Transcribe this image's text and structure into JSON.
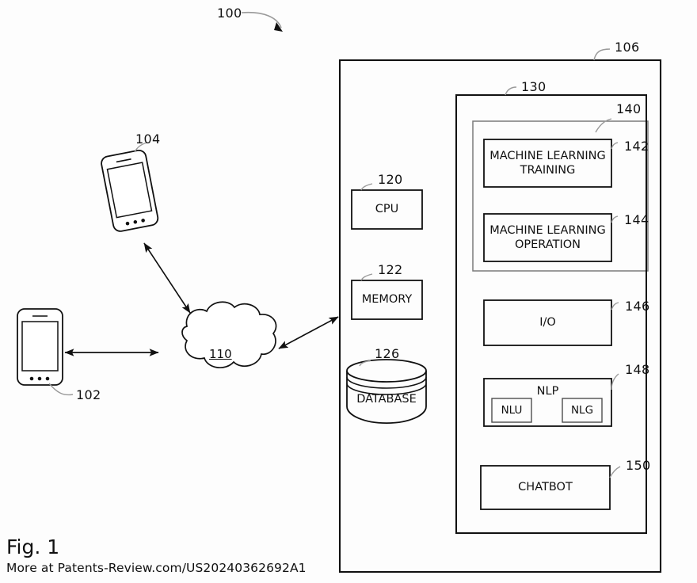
{
  "figure": {
    "caption": "Fig. 1",
    "footer": "More at Patents-Review.com/US20240362692A1",
    "top_ref": "100"
  },
  "network": {
    "cloud_label": "110",
    "devices": [
      {
        "ref": "104",
        "name": "mobile-device-upper"
      },
      {
        "ref": "102",
        "name": "mobile-device-lower"
      }
    ]
  },
  "server": {
    "ref": "106",
    "hardware": [
      {
        "ref": "120",
        "label": "CPU"
      },
      {
        "ref": "122",
        "label": "MEMORY"
      },
      {
        "ref": "126",
        "label": "DATABASE"
      }
    ],
    "modules_container_ref": "130",
    "ml_container_ref": "140",
    "modules": [
      {
        "ref": "142",
        "label": "MACHINE LEARNING\nTRAINING"
      },
      {
        "ref": "144",
        "label": "MACHINE LEARNING\nOPERATION"
      },
      {
        "ref": "146",
        "label": "I/O"
      },
      {
        "ref": "148",
        "label": "NLP"
      },
      {
        "ref": "150",
        "label": "CHATBOT"
      }
    ],
    "nlp_children": [
      {
        "label": "NLU"
      },
      {
        "label": "NLG"
      }
    ]
  }
}
